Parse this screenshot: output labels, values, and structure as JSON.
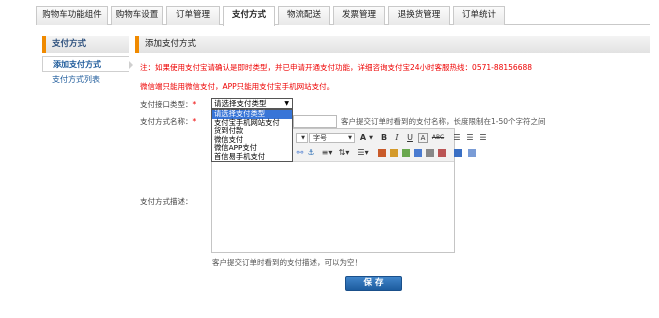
{
  "tabs": [
    {
      "label": "购物车功能组件"
    },
    {
      "label": "购物车设置"
    },
    {
      "label": "订单管理"
    },
    {
      "label": "支付方式"
    },
    {
      "label": "物流配送"
    },
    {
      "label": "发票管理"
    },
    {
      "label": "退换货管理"
    },
    {
      "label": "订单统计"
    }
  ],
  "sidebar": {
    "title": "支付方式",
    "items": [
      {
        "label": "添加支付方式"
      },
      {
        "label": "支付方式列表"
      }
    ]
  },
  "main": {
    "title": "添加支付方式",
    "notice_1": "注：如果使用支付宝请确认是即时类型，并已申请开通支付功能，详细咨询支付宝24小时客服热线：0571-88156688",
    "notice_2": "微信端只能用微信支付，APP只能用支付宝手机网站支付。",
    "interface_type_label": "支付接口类型：",
    "method_name_label": "支付方式名称：",
    "required_mark": "*",
    "method_name_hint": "客户提交订单时看到的支付名称，长度限制在1-50个字符之间",
    "description_label": "支付方式描述：",
    "description_hint": "客户提交订单时看到的支付描述，可以为空！",
    "save_label": "保 存"
  },
  "interface_select": {
    "selected": "请选择支付类型",
    "options": [
      "请选择支付类型",
      "支付宝手机网站支付",
      "货到付款",
      "微信支付",
      "微信APP支付",
      "首信易手机支付"
    ]
  },
  "editor_toolbar": {
    "font_size_label": "字号",
    "bold": "B",
    "italic": "I",
    "underline": "U",
    "strike": "ABC",
    "font_color": "A",
    "font_size_grow": "A"
  },
  "colors": {
    "accent": "#f08a00",
    "link": "#1d5a9a",
    "warning": "#ee0000",
    "save_button": "#2a6db4",
    "dropdown_highlight": "#3875d7"
  }
}
